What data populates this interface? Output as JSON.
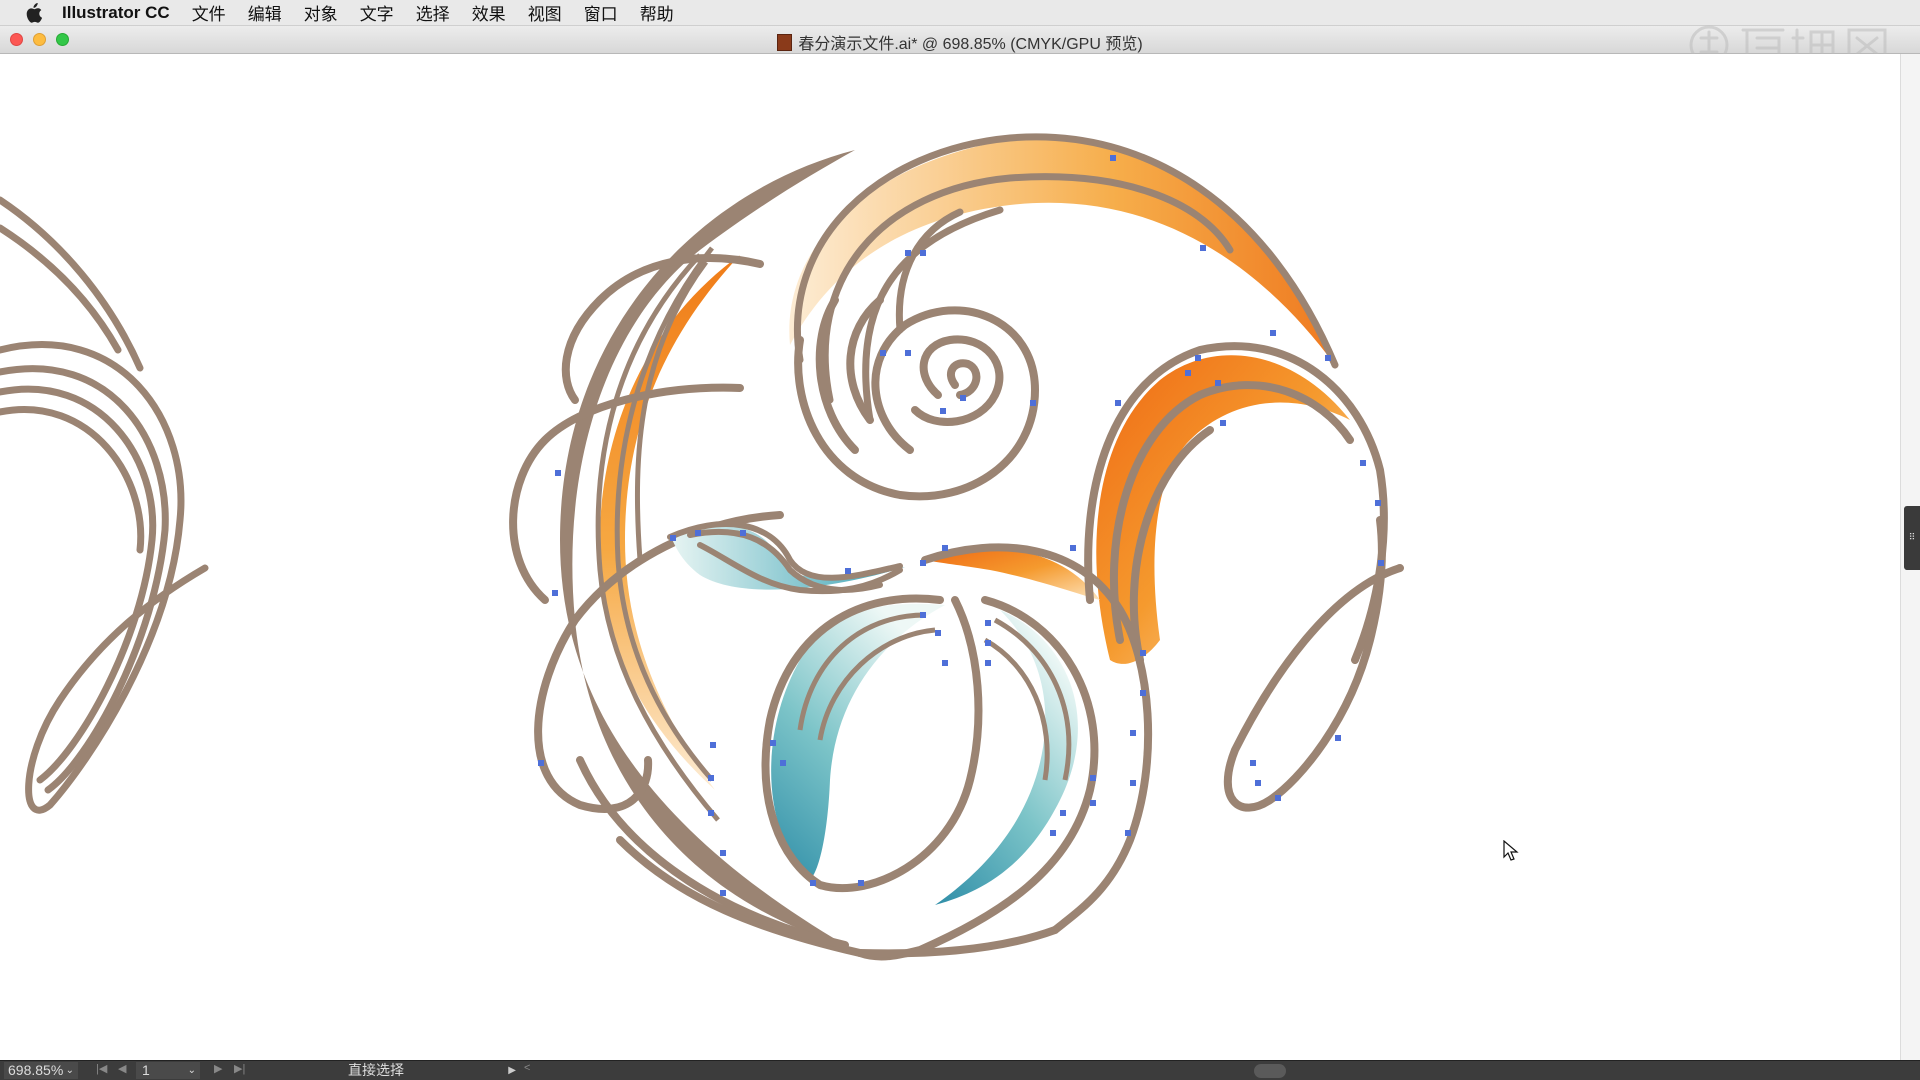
{
  "menubar": {
    "app_name": "Illustrator CC",
    "items": [
      "文件",
      "编辑",
      "对象",
      "文字",
      "选择",
      "效果",
      "视图",
      "窗口",
      "帮助"
    ]
  },
  "window": {
    "title": "春分演示文件.ai* @ 698.85% (CMYK/GPU 预览)"
  },
  "status": {
    "zoom": "698.85%",
    "page": "1",
    "tool": "直接选择"
  },
  "icons": {
    "apple": "apple-logo-icon",
    "doc": "ai-document-icon",
    "cursor": "arrow-cursor-icon"
  },
  "colors": {
    "stroke": "#9b8473",
    "anchor": "#4e6fd8",
    "orange": "#f07c18",
    "orange_light": "#fde2b4",
    "teal": "#3aa2b4",
    "teal_light": "#e3f3f3"
  }
}
